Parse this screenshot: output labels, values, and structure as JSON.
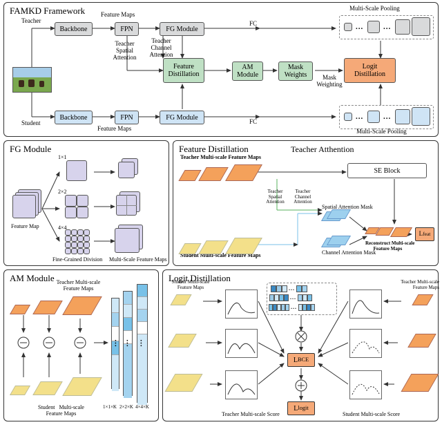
{
  "panel1": {
    "title": "FAMKD Framework",
    "teacher": "Teacher",
    "student": "Student",
    "backbone": "Backbone",
    "fpn": "FPN",
    "feature_maps": "Feature Maps",
    "fg_module": "FG Module",
    "teacher_spatial_attention": "Teacher\nSpatial\nAttention",
    "teacher_channel_attention": "Teacher\nChannel\nAttention",
    "feature_distillation": "Feature\nDistillation",
    "am_module": "AM\nModule",
    "mask_weights": "Mask\nWeights",
    "mask_weighting": "Mask\nWeighting",
    "logit_distillation": "Logit\nDistillation",
    "fc": "FC",
    "multi_scale_pooling_top": "Multi-Scale Pooling",
    "multi_scale_pooling_bottom": "Multi-Scale Pooling"
  },
  "panel2": {
    "title": "FG Module",
    "feature_map": "Feature Map",
    "s1": "1×1",
    "s2": "2×2",
    "s4": "4×4",
    "fine_grained": "Fine-Grained Division",
    "multi_scale": "Multi-Scale Feature Maps"
  },
  "panel3": {
    "title": "Feature Distillation",
    "teacher_attn": "Teacher Atthention",
    "teacher_maps": "Teacher Multi-scale Feature Maps",
    "student_maps": "Student Multi-scale Feature Maps",
    "se_block": "SE Block",
    "tsa": "Teacher\nSpatial\nAttention",
    "tca": "Teacher\nChannel\nAttention",
    "sam": "Spatial Attention Mask",
    "cam": "Channel Attention Mask",
    "recon": "Reconstruct Multi-scale\nFeature Maps",
    "lfeat": "Lₓₑₐₜ"
  },
  "panel4": {
    "title": "AM Module",
    "teacher_maps": "Teacher Multi-scale\nFeature Maps",
    "student_maps": "Student   Multi-scale\nFeature Maps",
    "k1": "1×1×K",
    "k2": "2×2×K",
    "k4": "4×4×K"
  },
  "panel5": {
    "title": "Logit Distillation",
    "student_maps": "Student Multi-scale\nFeature Maps",
    "teacher_maps": "Teacher Multi-scale\nFeature Maps",
    "teacher_score": "Teacher  Multi-scale Score",
    "student_score": "Student  Multi-scale Score",
    "lbce": "L_BCE",
    "llogit": "L_logit"
  },
  "misc": {
    "dots": "..."
  }
}
